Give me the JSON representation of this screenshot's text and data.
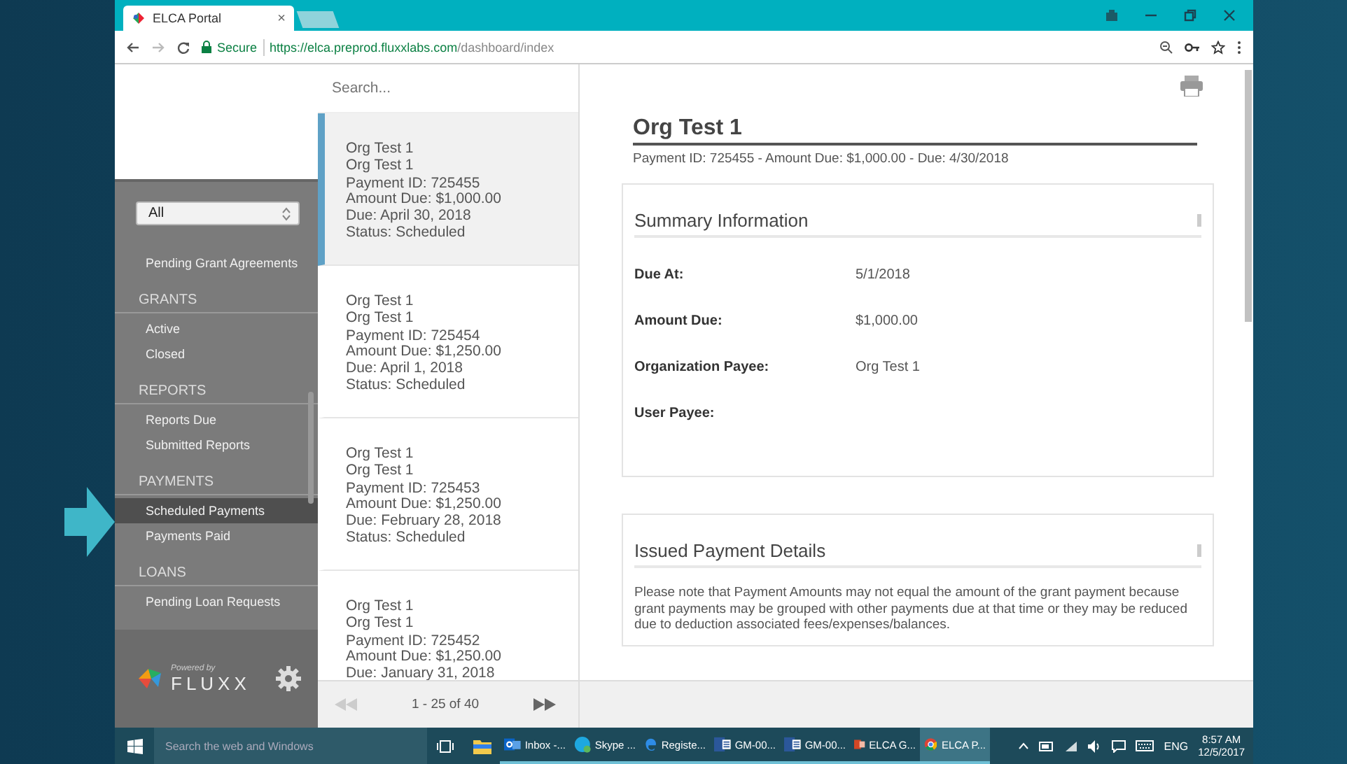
{
  "browser": {
    "tab": {
      "title": "ELCA Portal",
      "close": "×"
    },
    "secure_label": "Secure",
    "url_host": "https://elca.preprod.fluxxlabs.com",
    "url_path": "/dashboard/index"
  },
  "sidebar": {
    "filter": {
      "value": "All"
    },
    "top_items": [
      {
        "label": "Pending Grant Agreements",
        "selected": false
      }
    ],
    "sections": [
      {
        "title": "GRANTS",
        "items": [
          {
            "label": "Active",
            "selected": false
          },
          {
            "label": "Closed",
            "selected": false
          }
        ]
      },
      {
        "title": "REPORTS",
        "items": [
          {
            "label": "Reports Due",
            "selected": false
          },
          {
            "label": "Submitted Reports",
            "selected": false
          }
        ]
      },
      {
        "title": "PAYMENTS",
        "items": [
          {
            "label": "Scheduled Payments",
            "selected": true
          },
          {
            "label": "Payments Paid",
            "selected": false
          }
        ]
      },
      {
        "title": "LOANS",
        "items": [
          {
            "label": "Pending Loan Requests",
            "selected": false
          }
        ]
      }
    ],
    "powered_by": "Powered by",
    "brand": "FLUXX"
  },
  "list": {
    "search": {
      "placeholder": "Search..."
    },
    "items": [
      {
        "selected": true,
        "lines": [
          "Org Test 1",
          "Org Test 1",
          "Payment ID: 725455",
          "Amount Due: $1,000.00",
          "Due: April 30, 2018",
          "Status: Scheduled"
        ]
      },
      {
        "selected": false,
        "lines": [
          "Org Test 1",
          "Org Test 1",
          "Payment ID: 725454",
          "Amount Due: $1,250.00",
          "Due: April 1, 2018",
          "Status: Scheduled"
        ]
      },
      {
        "selected": false,
        "lines": [
          "Org Test 1",
          "Org Test 1",
          "Payment ID: 725453",
          "Amount Due: $1,250.00",
          "Due: February 28, 2018",
          "Status: Scheduled"
        ]
      },
      {
        "selected": false,
        "lines": [
          "Org Test 1",
          "Org Test 1",
          "Payment ID: 725452",
          "Amount Due: $1,250.00",
          "Due: January 31, 2018"
        ]
      }
    ],
    "pagination": {
      "range": "1 - 25 of 40",
      "prev_disabled": true,
      "next_disabled": false
    }
  },
  "detail": {
    "title": "Org Test 1",
    "subtitle": "Payment ID: 725455 - Amount Due: $1,000.00 - Due: 4/30/2018",
    "sections": [
      {
        "kind": "fields",
        "title": "Summary Information",
        "fields": [
          {
            "label": "Due At:",
            "value": "5/1/2018"
          },
          {
            "label": "Amount Due:",
            "value": "$1,000.00"
          },
          {
            "label": "Organization Payee:",
            "value": "Org Test 1"
          },
          {
            "label": "User Payee:"
          }
        ]
      },
      {
        "kind": "note",
        "title": "Issued Payment Details",
        "text": "Please note that Payment Amounts may not equal the amount of the grant payment because grant payments may be grouped with other payments due at that time or they may be reduced due to deduction associated fees/expenses/balances."
      }
    ]
  },
  "taskbar": {
    "search_placeholder": "Search the web and Windows",
    "apps": [
      {
        "kind": "outlook",
        "label": "Inbox -...",
        "selected": false
      },
      {
        "kind": "skype",
        "label": "Skype ...",
        "selected": false
      },
      {
        "kind": "edge",
        "label": "Registe...",
        "selected": false
      },
      {
        "kind": "word",
        "label": "GM-00...",
        "selected": false
      },
      {
        "kind": "word",
        "label": "GM-00...",
        "selected": false
      },
      {
        "kind": "powerpoint",
        "label": "ELCA G...",
        "selected": false
      },
      {
        "kind": "chrome",
        "label": "ELCA P...",
        "selected": true
      }
    ],
    "language": "ENG",
    "time": "8:57 AM",
    "date": "12/5/2017"
  }
}
